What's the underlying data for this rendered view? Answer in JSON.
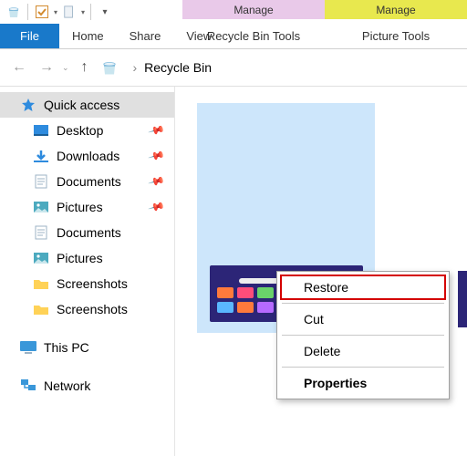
{
  "ctx_tabs": {
    "a": "Manage",
    "b": "Manage",
    "a_sub": "Recycle Bin Tools",
    "b_sub": "Picture Tools"
  },
  "tabs": {
    "file": "File",
    "home": "Home",
    "share": "Share",
    "view": "View"
  },
  "breadcrumb": {
    "location": "Recycle Bin",
    "sep": "›"
  },
  "sidebar": {
    "quick": "Quick access",
    "items": [
      {
        "label": "Desktop",
        "pin": true
      },
      {
        "label": "Downloads",
        "pin": true
      },
      {
        "label": "Documents",
        "pin": true
      },
      {
        "label": "Pictures",
        "pin": true
      },
      {
        "label": "Documents",
        "pin": false
      },
      {
        "label": "Pictures",
        "pin": false
      },
      {
        "label": "Screenshots",
        "pin": false
      },
      {
        "label": "Screenshots",
        "pin": false
      }
    ],
    "thispc": "This PC",
    "network": "Network"
  },
  "context_menu": {
    "restore": "Restore",
    "cut": "Cut",
    "delete": "Delete",
    "properties": "Properties"
  }
}
